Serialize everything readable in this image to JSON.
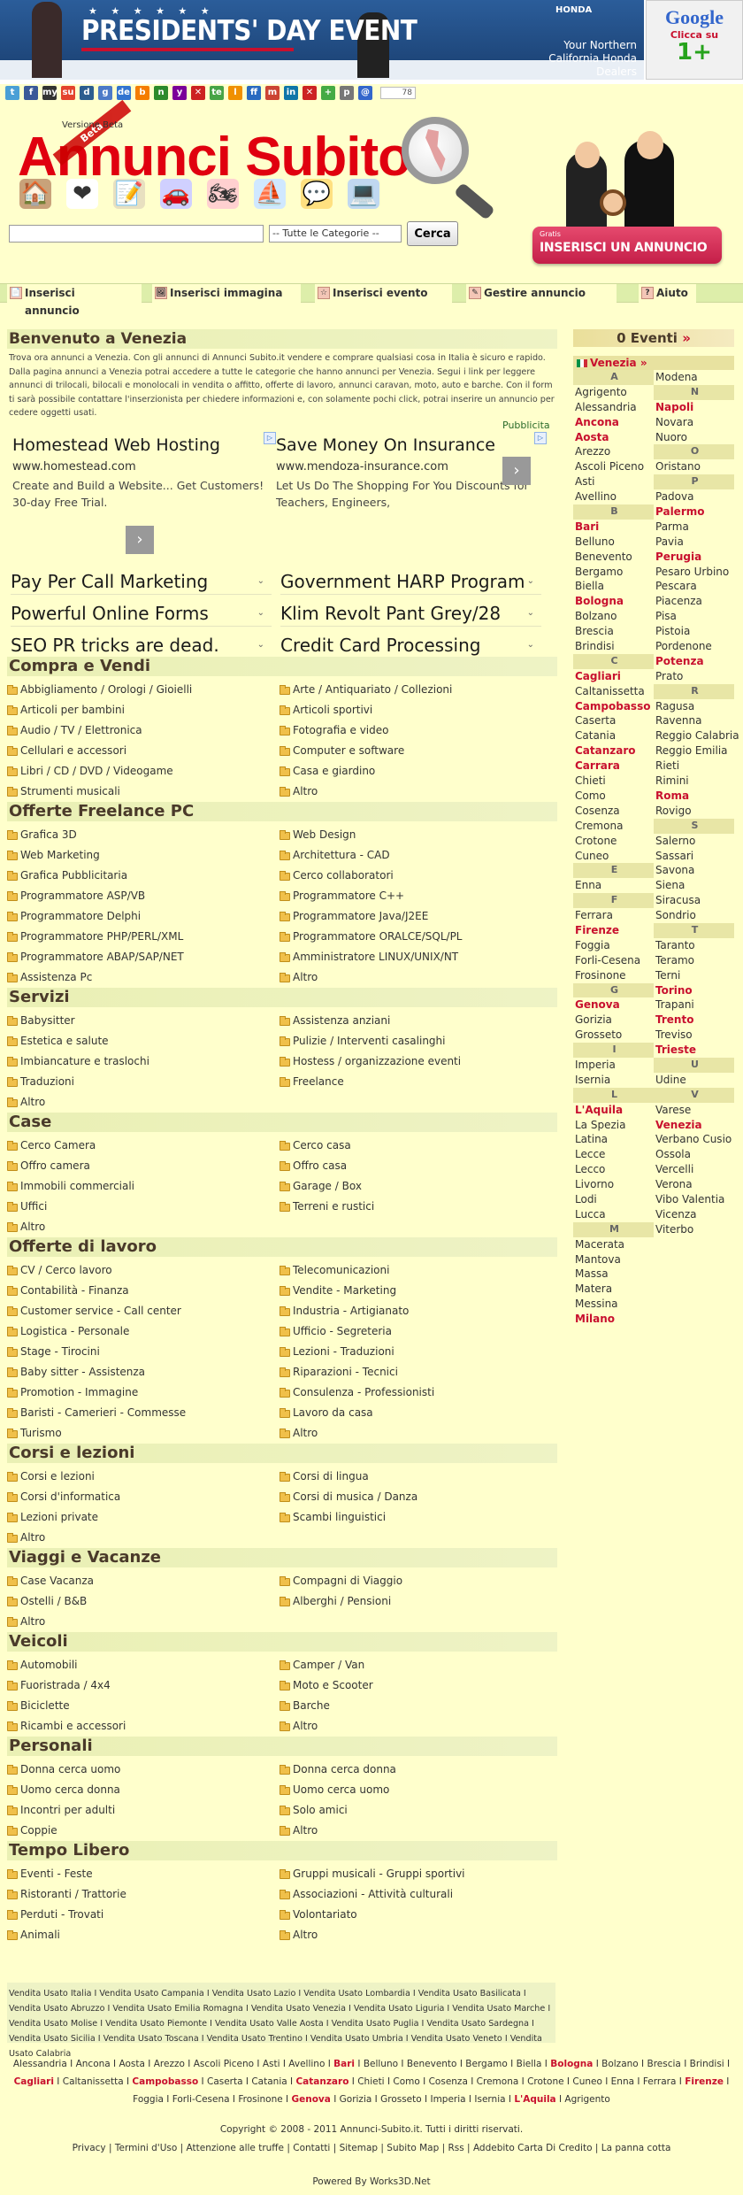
{
  "banner": {
    "stars": "★ ★ ★ ★ ★ ★",
    "event_title": "PRESIDENTS' DAY EVENT",
    "brand": "HONDA",
    "tagline": "Your Northern California Honda Dealers"
  },
  "google_ad": {
    "logo": "Google",
    "cta": "Clicca su",
    "plus": "1",
    "plus_sign": "+"
  },
  "share": {
    "icons": [
      {
        "name": "twitter-icon",
        "glyph": "t",
        "color": "#4a9fd6"
      },
      {
        "name": "facebook-icon",
        "glyph": "f",
        "color": "#3b5998"
      },
      {
        "name": "myspace-icon",
        "glyph": "my",
        "color": "#333333"
      },
      {
        "name": "stumbleupon-icon",
        "glyph": "su",
        "color": "#e4432d"
      },
      {
        "name": "digg-icon",
        "glyph": "d",
        "color": "#2c5d8f"
      },
      {
        "name": "google-icon",
        "glyph": "g",
        "color": "#4c7ac8"
      },
      {
        "name": "delicious-icon",
        "glyph": "de",
        "color": "#3274d0"
      },
      {
        "name": "blogger-icon",
        "glyph": "b",
        "color": "#f57d00"
      },
      {
        "name": "netvibes-icon",
        "glyph": "n",
        "color": "#2c8a2c"
      },
      {
        "name": "yahoo-icon",
        "glyph": "y",
        "color": "#7b0099"
      },
      {
        "name": "closed-icon-1",
        "glyph": "✕",
        "color": "#cc2222"
      },
      {
        "name": "technorati-icon",
        "glyph": "te",
        "color": "#47a447"
      },
      {
        "name": "live-icon",
        "glyph": "l",
        "color": "#f09000"
      },
      {
        "name": "friendfeed-icon",
        "glyph": "ff",
        "color": "#2a6ac0"
      },
      {
        "name": "mixx-icon",
        "glyph": "m",
        "color": "#c43"
      },
      {
        "name": "linkedin-icon",
        "glyph": "in",
        "color": "#0e76a8"
      },
      {
        "name": "closed-icon-2",
        "glyph": "✕",
        "color": "#cc2222"
      },
      {
        "name": "sharethis-icon",
        "glyph": "+",
        "color": "#44aa44"
      },
      {
        "name": "print-icon",
        "glyph": "p",
        "color": "#777777"
      },
      {
        "name": "email-icon",
        "glyph": "@",
        "color": "#3366cc"
      }
    ],
    "count": "78"
  },
  "header": {
    "versione": "Versione Beta",
    "beta": "Beta",
    "title": "Annunci Subito",
    "category_icons": [
      {
        "name": "house-icon",
        "glyph": "🏠",
        "color": "#c8a27a"
      },
      {
        "name": "heart-icon",
        "glyph": "❤",
        "color": "#ffffff"
      },
      {
        "name": "document-icon",
        "glyph": "📝",
        "color": "#e8e0c0"
      },
      {
        "name": "car-icon",
        "glyph": "🚗",
        "color": "#d0d0ff"
      },
      {
        "name": "motorbike-icon",
        "glyph": "🏍",
        "color": "#ffd0d0"
      },
      {
        "name": "boat-icon",
        "glyph": "⛵",
        "color": "#d0e8ff"
      },
      {
        "name": "chat-icon",
        "glyph": "💬",
        "color": "#ffe080"
      },
      {
        "name": "computer-icon",
        "glyph": "💻",
        "color": "#c0d8f0"
      }
    ],
    "search_placeholder": "",
    "category_select": "-- Tutte le Categorie --",
    "search_button": "Cerca",
    "cta_gratis": "Gratis",
    "cta_label": "INSERISCI UN ANNUNCIO"
  },
  "nav": [
    {
      "label": "Inserisci annuncio",
      "icon": "📄"
    },
    {
      "label": "Inserisci immagina",
      "icon": "🖼"
    },
    {
      "label": "Inserisci evento",
      "icon": "☆"
    },
    {
      "label": "Gestire annuncio",
      "icon": "✎"
    },
    {
      "label": "Aiuto",
      "icon": "?"
    }
  ],
  "welcome": {
    "title": "Benvenuto a Venezia",
    "text": "Trova ora annunci a Venezia. Con gli annunci di Annunci Subito.it vendere e comprare qualsiasi cosa in Italia è sicuro e rapido. Dalla pagina annunci a Venezia potrai accedere a tutte le categorie che hanno annunci per Venezia. Segui i link per leggere annunci di trilocali, bilocali e monolocali in vendita o affitto, offerte di lavoro, annunci caravan, moto, auto e barche. Con il form ti sarà possibile contattare l'inserzionista per chiedere informazioni e, con solamente pochi click, potrai inserire un annuncio per cedere oggetti usati."
  },
  "ads": {
    "label": "Pubblicita",
    "left": {
      "title": "Homestead Web Hosting",
      "url": "www.homestead.com",
      "desc": "Create and Build a Website... Get Customers! 30-day Free Trial."
    },
    "right": {
      "title": "Save Money On Insurance",
      "url": "www.mendoza-insurance.com",
      "desc": "Let Us Do The Shopping For You Discounts for Teachers, Engineers,"
    },
    "arrow": "›",
    "adchoice": "▷",
    "keywords": [
      [
        "Pay Per Call Marketing",
        "Government HARP Program"
      ],
      [
        "Powerful Online Forms",
        "Klim Revolt Pant Grey/28"
      ],
      [
        "SEO PR tricks are dead.",
        "Credit Card Processing"
      ]
    ],
    "chev": "⌄"
  },
  "sections": [
    {
      "title": "Compra e Vendi",
      "items": [
        "Abbigliamento / Orologi / Gioielli",
        "Arte / Antiquariato / Collezioni",
        "Articoli per bambini",
        "Articoli sportivi",
        "Audio / TV / Elettronica",
        "Fotografia e video",
        "Cellulari e accessori",
        "Computer e software",
        "Libri / CD / DVD / Videogame",
        "Casa e giardino",
        "Strumenti musicali",
        "Altro"
      ]
    },
    {
      "title": "Offerte Freelance PC",
      "items": [
        "Grafica 3D",
        "Web Design",
        "Web Marketing",
        "Architettura - CAD",
        "Grafica Pubblicitaria",
        "Cerco collaboratori",
        "Programmatore ASP/VB",
        "Programmatore C++",
        "Programmatore Delphi",
        "Programmatore Java/J2EE",
        "Programmatore PHP/PERL/XML",
        "Programmatore ORALCE/SQL/PL",
        "Programmatore ABAP/SAP/NET",
        "Amministratore LINUX/UNIX/NT",
        "Assistenza Pc",
        "Altro"
      ]
    },
    {
      "title": "Servizi",
      "items": [
        "Babysitter",
        "Assistenza anziani",
        "Estetica e salute",
        "Pulizie / Interventi casalinghi",
        "Imbiancature e traslochi",
        "Hostess / organizzazione eventi",
        "Traduzioni",
        "Freelance",
        "Altro"
      ]
    },
    {
      "title": "Case",
      "items": [
        "Cerco Camera",
        "Cerco casa",
        "Offro camera",
        "Offro casa",
        "Immobili commerciali",
        "Garage / Box",
        "Uffici",
        "Terreni e rustici",
        "Altro"
      ]
    },
    {
      "title": "Offerte di lavoro",
      "items": [
        "CV / Cerco lavoro",
        "Telecomunicazioni",
        "Contabilità - Finanza",
        "Vendite - Marketing",
        " Customer service - Call center",
        "Industria - Artigianato",
        "Logistica - Personale",
        "Ufficio - Segreteria",
        "Stage - Tirocini",
        "Lezioni - Traduzioni",
        "Baby sitter - Assistenza",
        "Riparazioni - Tecnici",
        "Promotion - Immagine",
        "Consulenza - Professionisti",
        "Baristi - Camerieri - Commesse",
        "Lavoro da casa",
        "Turismo",
        "Altro"
      ]
    },
    {
      "title": "Corsi e lezioni",
      "items": [
        "Corsi e lezioni",
        "Corsi di lingua",
        "Corsi d'informatica",
        "Corsi di musica / Danza",
        "Lezioni private",
        "Scambi linguistici",
        "Altro"
      ]
    },
    {
      "title": "Viaggi e Vacanze",
      "items": [
        "Case Vacanza",
        "Compagni di Viaggio",
        "Ostelli / B&B",
        "Alberghi / Pensioni",
        "Altro"
      ]
    },
    {
      "title": "Veicoli",
      "items": [
        "Automobili",
        "Camper / Van",
        "Fuoristrada / 4x4",
        "Moto e Scooter",
        "Biciclette",
        "Barche",
        "Ricambi e accessori",
        "Altro"
      ]
    },
    {
      "title": "Personali",
      "items": [
        "Donna cerca uomo",
        "Donna cerca donna",
        "Uomo cerca donna",
        "Uomo cerca uomo",
        "Incontri per adulti",
        "Solo amici",
        "Coppie",
        "Altro"
      ]
    },
    {
      "title": "Tempo Libero",
      "items": [
        "Eventi - Feste",
        "Gruppi musicali - Gruppi sportivi",
        "Ristoranti / Trattorie",
        "Associazioni - Attività culturali",
        "Perduti - Trovati",
        "Volontariato",
        "Animali",
        "Altro"
      ]
    }
  ],
  "sidebar": {
    "eventi_title": "0 Eventi",
    "eventi_arrow": "»",
    "current_city": "Venezia",
    "current_arrow": "»",
    "col1": [
      {
        "t": "A",
        "k": "letter"
      },
      {
        "t": "Agrigento"
      },
      {
        "t": "Alessandria"
      },
      {
        "t": "Ancona",
        "k": "bold"
      },
      {
        "t": "Aosta",
        "k": "bold"
      },
      {
        "t": "Arezzo"
      },
      {
        "t": "Ascoli Piceno"
      },
      {
        "t": "Asti"
      },
      {
        "t": "Avellino"
      },
      {
        "t": "B",
        "k": "letter"
      },
      {
        "t": "Bari",
        "k": "bold"
      },
      {
        "t": "Belluno"
      },
      {
        "t": "Benevento"
      },
      {
        "t": "Bergamo"
      },
      {
        "t": "Biella"
      },
      {
        "t": "Bologna",
        "k": "bold"
      },
      {
        "t": "Bolzano"
      },
      {
        "t": "Brescia"
      },
      {
        "t": "Brindisi"
      },
      {
        "t": "C",
        "k": "letter"
      },
      {
        "t": "Cagliari",
        "k": "bold"
      },
      {
        "t": "Caltanissetta"
      },
      {
        "t": "Campobasso",
        "k": "bold"
      },
      {
        "t": "Caserta"
      },
      {
        "t": "Catania"
      },
      {
        "t": "Catanzaro",
        "k": "bold"
      },
      {
        "t": "Carrara",
        "k": "bold"
      },
      {
        "t": "Chieti"
      },
      {
        "t": "Como"
      },
      {
        "t": "Cosenza"
      },
      {
        "t": "Cremona"
      },
      {
        "t": "Crotone"
      },
      {
        "t": "Cuneo"
      },
      {
        "t": "E",
        "k": "letter"
      },
      {
        "t": "Enna"
      },
      {
        "t": "F",
        "k": "letter"
      },
      {
        "t": "Ferrara"
      },
      {
        "t": "Firenze",
        "k": "bold"
      },
      {
        "t": "Foggia"
      },
      {
        "t": "Forli-Cesena"
      },
      {
        "t": "Frosinone"
      },
      {
        "t": "G",
        "k": "letter"
      },
      {
        "t": "Genova",
        "k": "bold"
      },
      {
        "t": "Gorizia"
      },
      {
        "t": "Grosseto"
      },
      {
        "t": "I",
        "k": "letter"
      },
      {
        "t": "Imperia"
      },
      {
        "t": "Isernia"
      },
      {
        "t": "L",
        "k": "letter"
      },
      {
        "t": "L'Aquila",
        "k": "bold"
      },
      {
        "t": "La Spezia"
      },
      {
        "t": "Latina"
      },
      {
        "t": "Lecce"
      },
      {
        "t": "Lecco"
      },
      {
        "t": "Livorno"
      },
      {
        "t": "Lodi"
      },
      {
        "t": "Lucca"
      },
      {
        "t": "M",
        "k": "letter"
      },
      {
        "t": "Macerata"
      },
      {
        "t": "Mantova"
      },
      {
        "t": "Massa"
      },
      {
        "t": "Matera"
      },
      {
        "t": "Messina"
      },
      {
        "t": "Milano",
        "k": "bold"
      }
    ],
    "col2": [
      {
        "t": "Modena"
      },
      {
        "t": "N",
        "k": "letter"
      },
      {
        "t": "Napoli",
        "k": "bold"
      },
      {
        "t": "Novara"
      },
      {
        "t": "Nuoro"
      },
      {
        "t": "O",
        "k": "letter"
      },
      {
        "t": "Oristano"
      },
      {
        "t": "P",
        "k": "letter"
      },
      {
        "t": "Padova"
      },
      {
        "t": "Palermo",
        "k": "bold"
      },
      {
        "t": "Parma"
      },
      {
        "t": "Pavia"
      },
      {
        "t": "Perugia",
        "k": "bold"
      },
      {
        "t": "Pesaro Urbino"
      },
      {
        "t": "Pescara"
      },
      {
        "t": "Piacenza"
      },
      {
        "t": "Pisa"
      },
      {
        "t": "Pistoia"
      },
      {
        "t": "Pordenone"
      },
      {
        "t": "Potenza",
        "k": "bold"
      },
      {
        "t": "Prato"
      },
      {
        "t": "R",
        "k": "letter"
      },
      {
        "t": "Ragusa"
      },
      {
        "t": "Ravenna"
      },
      {
        "t": "Reggio Calabria"
      },
      {
        "t": "Reggio Emilia"
      },
      {
        "t": "Rieti"
      },
      {
        "t": "Rimini"
      },
      {
        "t": "Roma",
        "k": "bold"
      },
      {
        "t": "Rovigo"
      },
      {
        "t": "S",
        "k": "letter"
      },
      {
        "t": "Salerno"
      },
      {
        "t": "Sassari"
      },
      {
        "t": "Savona"
      },
      {
        "t": "Siena"
      },
      {
        "t": "Siracusa"
      },
      {
        "t": "Sondrio"
      },
      {
        "t": "T",
        "k": "letter"
      },
      {
        "t": "Taranto"
      },
      {
        "t": "Teramo"
      },
      {
        "t": "Terni"
      },
      {
        "t": "Torino",
        "k": "bold"
      },
      {
        "t": "Trapani"
      },
      {
        "t": "Trento",
        "k": "bold"
      },
      {
        "t": "Treviso"
      },
      {
        "t": "Trieste",
        "k": "bold"
      },
      {
        "t": "U",
        "k": "letter"
      },
      {
        "t": "Udine"
      },
      {
        "t": "V",
        "k": "letter"
      },
      {
        "t": "Varese"
      },
      {
        "t": "Venezia",
        "k": "bold"
      },
      {
        "t": "Verbano Cusio"
      },
      {
        "t": "Ossola"
      },
      {
        "t": "Vercelli"
      },
      {
        "t": "Verona"
      },
      {
        "t": "Vibo Valentia"
      },
      {
        "t": "Vicenza"
      },
      {
        "t": "Viterbo"
      }
    ]
  },
  "footer": {
    "seo": "Vendita Usato Italia I Vendita Usato Campania I Vendita Usato Lazio I Vendita Usato Lombardia I Vendita Usato Basilicata I Vendita Usato Abruzzo I Vendita Usato Emilia Romagna I Vendita Usato Venezia I Vendita Usato Liguria I Vendita Usato Marche I Vendita Usato Molise I Vendita Usato Piemonte I Vendita Usato Valle Aosta I Vendita Usato Puglia I Vendita Usato Sardegna I Vendita Usato Sicilia I Vendita Usato Toscana I Vendita Usato Trentino I Vendita Usato Umbria I Vendita Usato Veneto I Vendita Usato Calabria",
    "cities": [
      {
        "t": "Alessandria"
      },
      {
        "t": "Ancona"
      },
      {
        "t": "Aosta"
      },
      {
        "t": "Arezzo"
      },
      {
        "t": "Ascoli Piceno"
      },
      {
        "t": "Asti"
      },
      {
        "t": "Avellino"
      },
      {
        "t": "Bari",
        "b": true
      },
      {
        "t": "Belluno"
      },
      {
        "t": "Benevento"
      },
      {
        "t": "Bergamo"
      },
      {
        "t": "Biella"
      },
      {
        "t": "Bologna",
        "b": true
      },
      {
        "t": "Bolzano"
      },
      {
        "t": "Brescia"
      },
      {
        "t": "Brindisi"
      },
      {
        "t": "Cagliari",
        "b": true
      },
      {
        "t": "Caltanissetta"
      },
      {
        "t": "Campobasso",
        "b": true
      },
      {
        "t": "Caserta"
      },
      {
        "t": "Catania"
      },
      {
        "t": "Catanzaro",
        "b": true
      },
      {
        "t": "Chieti"
      },
      {
        "t": "Como"
      },
      {
        "t": "Cosenza"
      },
      {
        "t": "Cremona"
      },
      {
        "t": "Crotone"
      },
      {
        "t": "Cuneo"
      },
      {
        "t": "Enna"
      },
      {
        "t": "Ferrara"
      },
      {
        "t": "Firenze",
        "b": true
      },
      {
        "t": "Foggia"
      },
      {
        "t": "Forli-Cesena"
      },
      {
        "t": "Frosinone"
      },
      {
        "t": "Genova",
        "b": true
      },
      {
        "t": "Gorizia"
      },
      {
        "t": "Grosseto"
      },
      {
        "t": "Imperia"
      },
      {
        "t": "Isernia"
      },
      {
        "t": "L'Aquila",
        "b": true
      },
      {
        "t": "Agrigento"
      }
    ],
    "copyright": "Copyright © 2008 - 2011 Annunci-Subito.it. Tutti i diritti riservati.",
    "links": [
      "Privacy",
      "Termini d'Uso",
      "Attenzione alle truffe",
      "Contatti",
      "Sitemap",
      "Subito Map",
      "Rss",
      "Addebito Carta Di Credito",
      "La panna cotta"
    ],
    "powered": "Powered By Works3D.Net"
  }
}
